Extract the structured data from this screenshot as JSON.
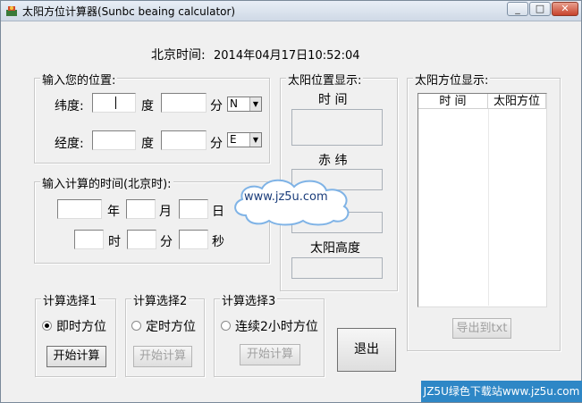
{
  "window": {
    "title": "太阳方位计算器(Sunbc beaing calculator)",
    "controls": [
      "_",
      "□",
      "✕"
    ]
  },
  "clock": {
    "label": "北京时间:",
    "value": "2014年04月17日10:52:04"
  },
  "position": {
    "legend": "输入您的位置:",
    "lat_label": "纬度:",
    "lon_label": "经度:",
    "deg": "度",
    "min": "分",
    "lat_dir": "N",
    "lon_dir": "E"
  },
  "calc_time": {
    "legend": "输入计算的时间(北京时):",
    "year": "年",
    "month": "月",
    "day": "日",
    "hour": "时",
    "minute": "分",
    "second": "秒"
  },
  "sun_pos": {
    "legend": "太阳位置显示:",
    "time": "时 间",
    "declination": "赤 纬",
    "hidden_label": "",
    "altitude": "太阳高度"
  },
  "azimuth": {
    "legend": "太阳方位显示:",
    "col_time": "时 间",
    "col_azimuth": "太阳方位",
    "export": "导出到txt"
  },
  "choice1": {
    "legend": "计算选择1",
    "option": "即时方位",
    "button": "开始计算",
    "selected": true
  },
  "choice2": {
    "legend": "计算选择2",
    "option": "定时方位",
    "button": "开始计算",
    "selected": false
  },
  "choice3": {
    "legend": "计算选择3",
    "option": "连续2小时方位",
    "button": "开始计算",
    "selected": false
  },
  "exit_label": "退出",
  "watermark": "www.jz5u.com",
  "banner": "JZ5U绿色下载站www.jz5u.com"
}
